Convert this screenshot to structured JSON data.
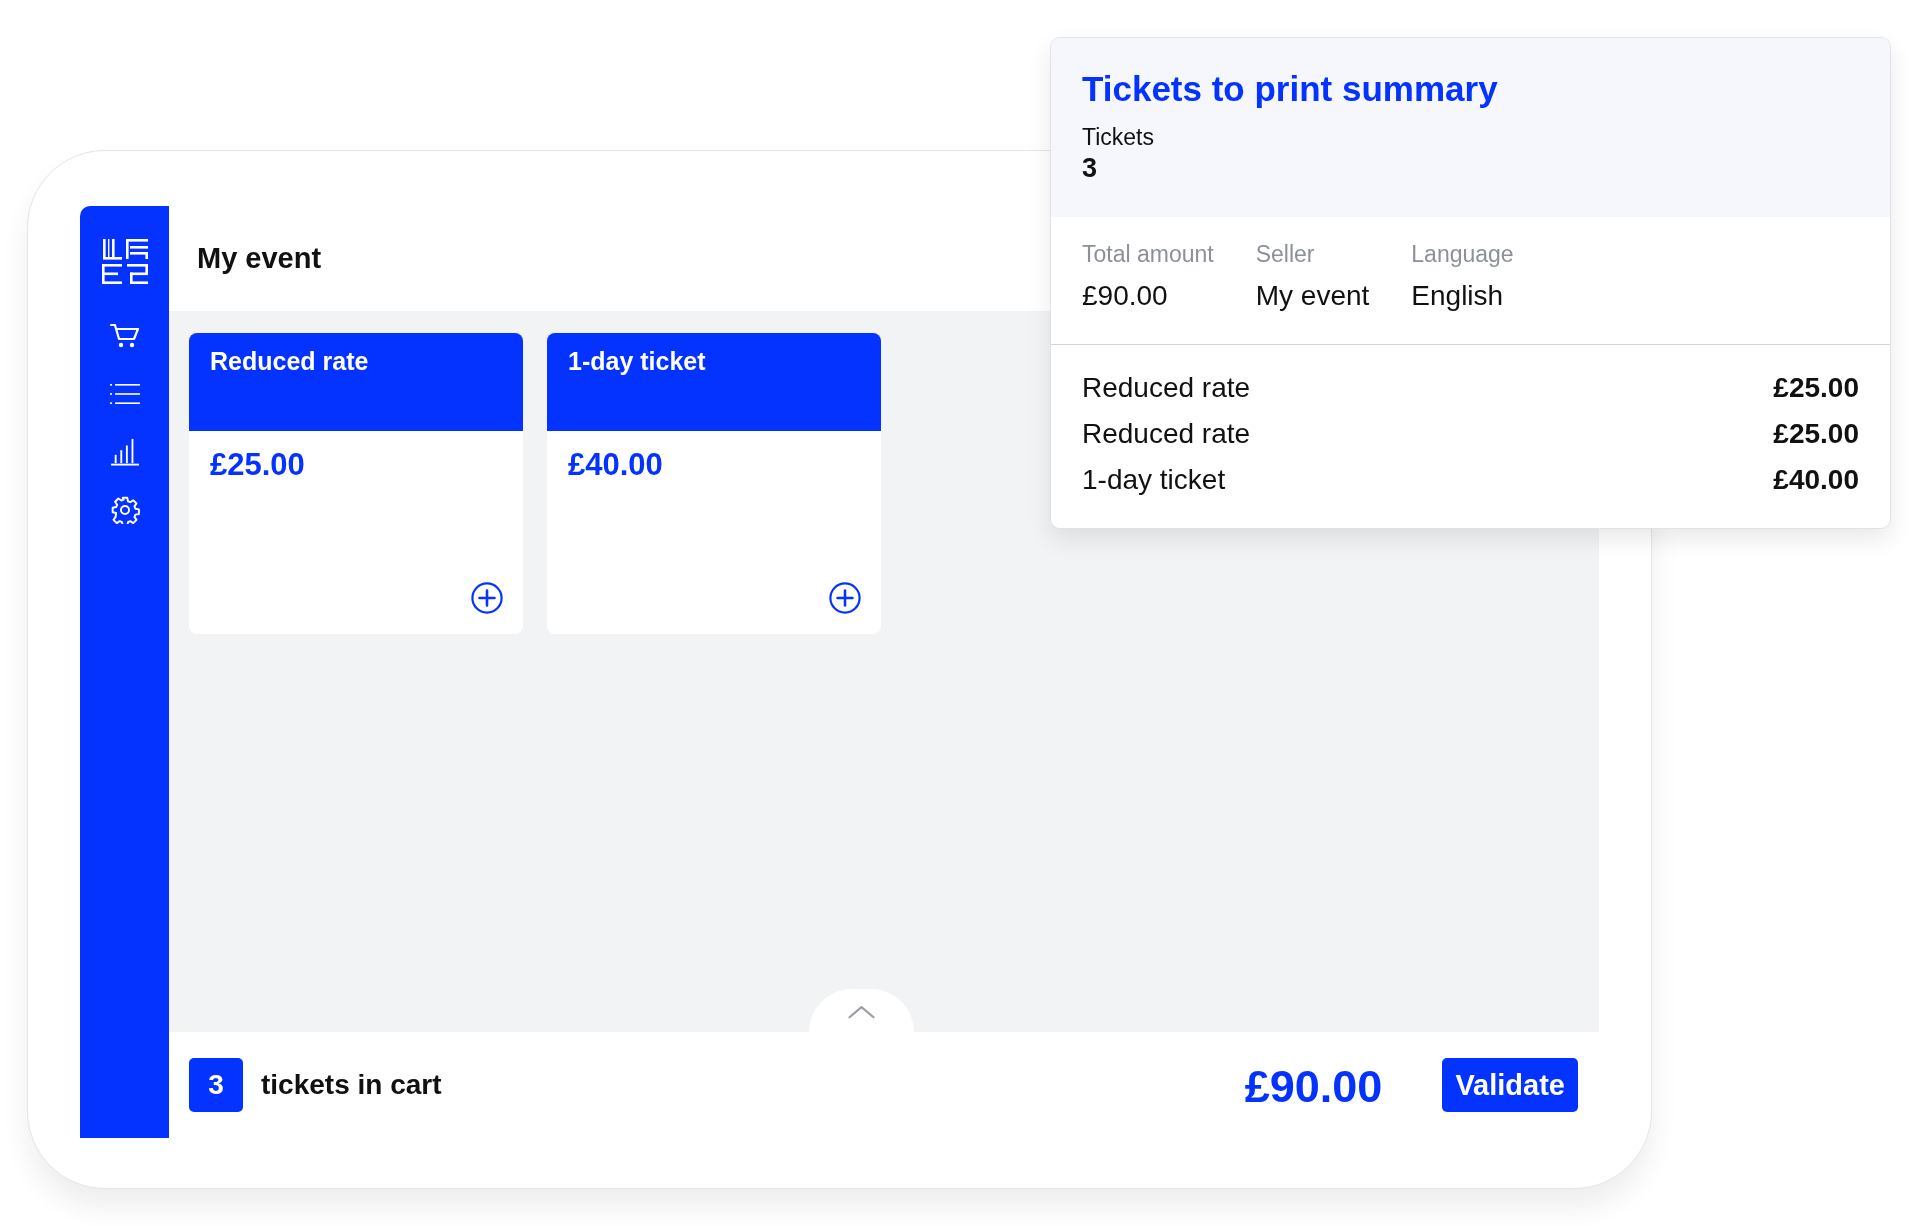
{
  "header": {
    "title": "My event"
  },
  "tickets": [
    {
      "name": "Reduced rate",
      "price": "£25.00"
    },
    {
      "name": "1-day ticket",
      "price": "£40.00"
    }
  ],
  "cart_bar": {
    "count": "3",
    "label": "tickets in cart",
    "total": "£90.00",
    "button": "Validate"
  },
  "summary": {
    "title": "Tickets to print summary",
    "tickets_label": "Tickets",
    "tickets_count": "3",
    "details": [
      {
        "label": "Total amount",
        "value": "£90.00"
      },
      {
        "label": "Seller",
        "value": "My event"
      },
      {
        "label": "Language",
        "value": "English"
      }
    ],
    "items": [
      {
        "name": "Reduced rate",
        "price": "£25.00"
      },
      {
        "name": "Reduced rate",
        "price": "£25.00"
      },
      {
        "name": "1-day ticket",
        "price": "£40.00"
      }
    ]
  }
}
